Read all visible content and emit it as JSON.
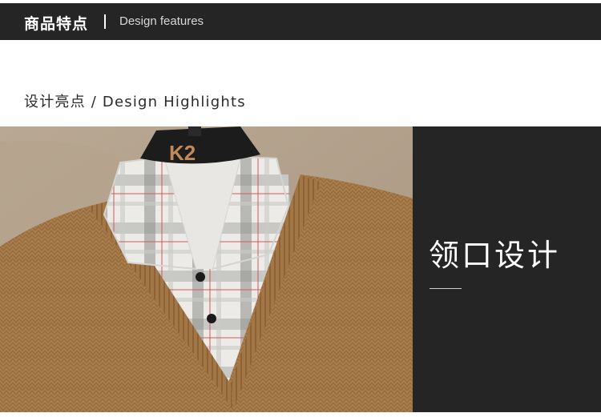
{
  "header": {
    "title_cn": "商品特点",
    "title_en": "Design features"
  },
  "section": {
    "title": "设计亮点 / Design Highlights"
  },
  "photo": {
    "hanger_logo": "K2"
  },
  "feature": {
    "title": "领口设计"
  },
  "colors": {
    "header_bg": "#252525",
    "panel_bg": "#252525",
    "sweater": "#a97d4b",
    "hanger": "#1c1c1c"
  }
}
